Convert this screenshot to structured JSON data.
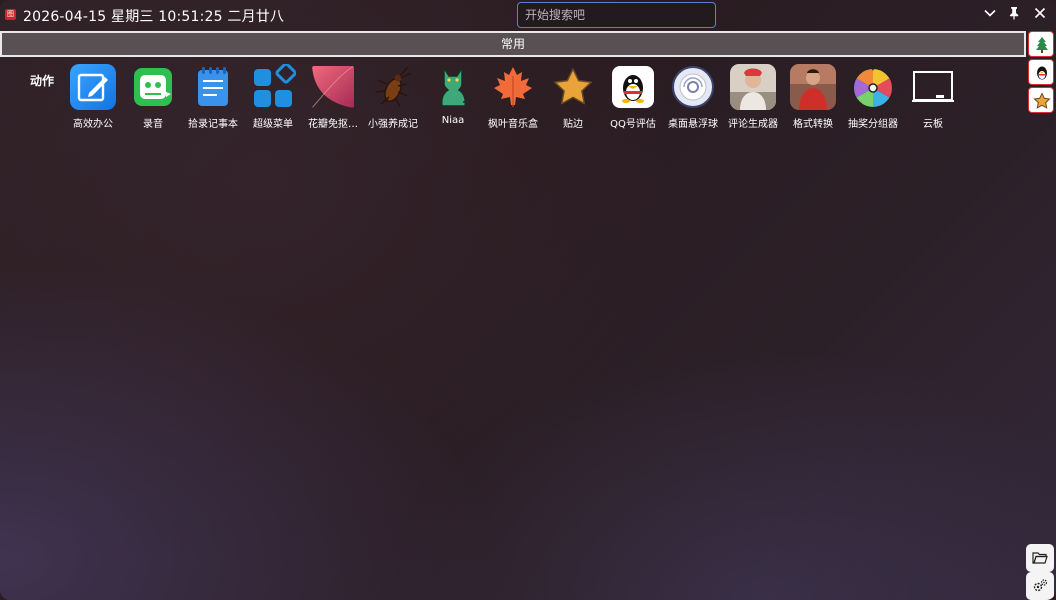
{
  "titlebar": {
    "app_icon_text": "图",
    "datetime": "2026-04-15 星期三 10:51:25 二月廿八",
    "search_placeholder": "开始搜索吧"
  },
  "category_tab": {
    "label": "常用"
  },
  "section": {
    "label": "动作"
  },
  "apps": [
    {
      "label": "高效办公",
      "icon": "pen-note-icon",
      "color": "#1d8bf0"
    },
    {
      "label": "录音",
      "icon": "recorder-icon",
      "color": "#30c24a"
    },
    {
      "label": "拾录记事本",
      "icon": "notepad-icon",
      "color": "#3a93ea"
    },
    {
      "label": "超级菜单",
      "icon": "tiles-icon",
      "color": "#1f8fe0"
    },
    {
      "label": "花瓣免抠…",
      "icon": "petal-icon",
      "color": "#e84a5f"
    },
    {
      "label": "小强养成记",
      "icon": "cockroach-icon",
      "color": "#8a4a1a"
    },
    {
      "label": "Niaa",
      "icon": "cat-icon",
      "color": "#3ea87a"
    },
    {
      "label": "枫叶音乐盒",
      "icon": "maple-leaf-icon",
      "color": "#f06a3a"
    },
    {
      "label": "贴边",
      "icon": "star-icon",
      "color": "#e8a33a"
    },
    {
      "label": "QQ号评估",
      "icon": "qq-penguin-icon",
      "color": "#ffffff"
    },
    {
      "label": "桌面悬浮球",
      "icon": "floating-ball-icon",
      "color": "#e0e4ef"
    },
    {
      "label": "评论生成器",
      "icon": "photo-thumbnail-icon",
      "color": "#d94a4a"
    },
    {
      "label": "格式转换",
      "icon": "photo-thumbnail-icon",
      "color": "#c8322e"
    },
    {
      "label": "抽奖分组器",
      "icon": "prize-wheel-icon",
      "color": "#f2c230"
    },
    {
      "label": "云板",
      "icon": "whiteboard-icon",
      "color": "#ffffff"
    }
  ],
  "dock": {
    "top": [
      "tree-icon",
      "qq-penguin-icon",
      "star-icon"
    ],
    "bottom": [
      "folder-icon",
      "settings-icon"
    ]
  }
}
